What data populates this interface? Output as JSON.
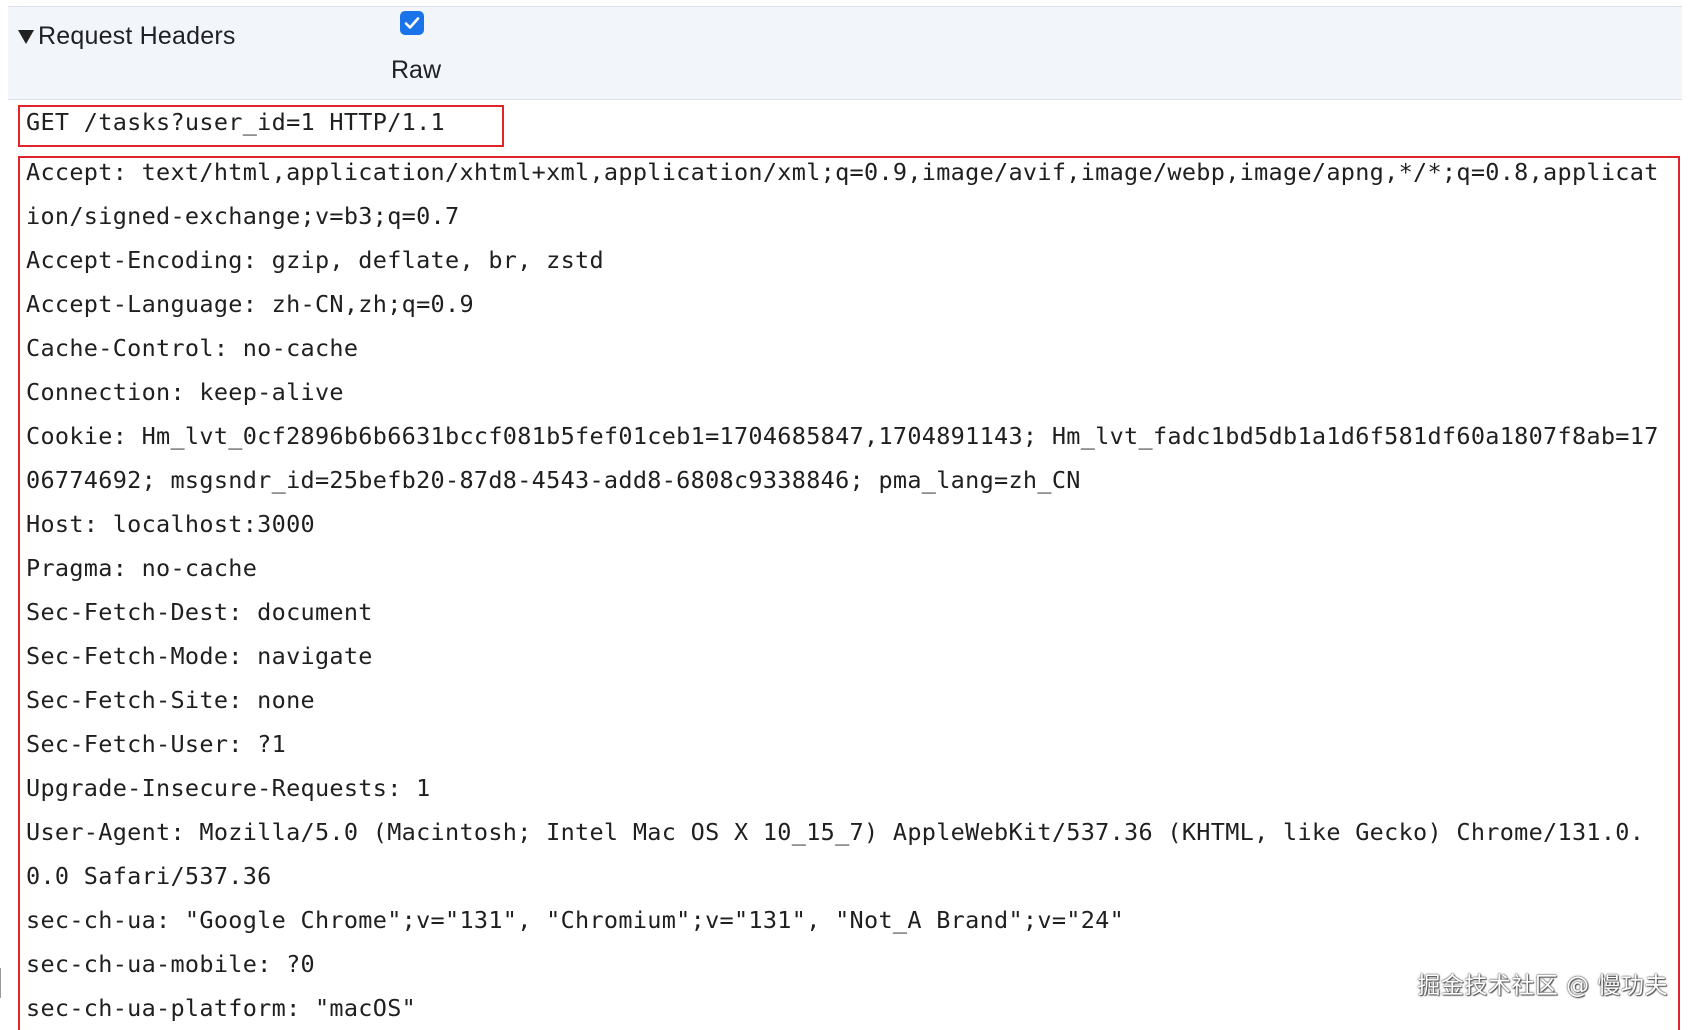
{
  "request_headers_section": {
    "title": "Request Headers",
    "raw_label": "Raw",
    "raw_checked": true
  },
  "raw": {
    "request_line": "GET /tasks?user_id=1 HTTP/1.1",
    "lines": [
      "Accept: text/html,application/xhtml+xml,application/xml;q=0.9,image/avif,image/webp,image/apng,*/*;q=0.8,applicat",
      "ion/signed-exchange;v=b3;q=0.7",
      "Accept-Encoding: gzip, deflate, br, zstd",
      "Accept-Language: zh-CN,zh;q=0.9",
      "Cache-Control: no-cache",
      "Connection: keep-alive",
      "Cookie: Hm_lvt_0cf2896b6b6631bccf081b5fef01ceb1=1704685847,1704891143; Hm_lvt_fadc1bd5db1a1d6f581df60a1807f8ab=17",
      "06774692; msgsndr_id=25befb20-87d8-4543-add8-6808c9338846; pma_lang=zh_CN",
      "Host: localhost:3000",
      "Pragma: no-cache",
      "Sec-Fetch-Dest: document",
      "Sec-Fetch-Mode: navigate",
      "Sec-Fetch-Site: none",
      "Sec-Fetch-User: ?1",
      "Upgrade-Insecure-Requests: 1",
      "User-Agent: Mozilla/5.0 (Macintosh; Intel Mac OS X 10_15_7) AppleWebKit/537.36 (KHTML, like Gecko) Chrome/131.0.",
      "0.0 Safari/537.36",
      "sec-ch-ua: \"Google Chrome\";v=\"131\", \"Chromium\";v=\"131\", \"Not_A Brand\";v=\"24\"",
      "sec-ch-ua-mobile: ?0",
      "sec-ch-ua-platform: \"macOS\""
    ]
  },
  "watermark": "掘金技术社区 @ 慢功夫",
  "colors": {
    "highlight_border": "#e0242b",
    "checkbox_fill": "#1a73e8",
    "header_bar_bg": "#f2f5fa"
  }
}
